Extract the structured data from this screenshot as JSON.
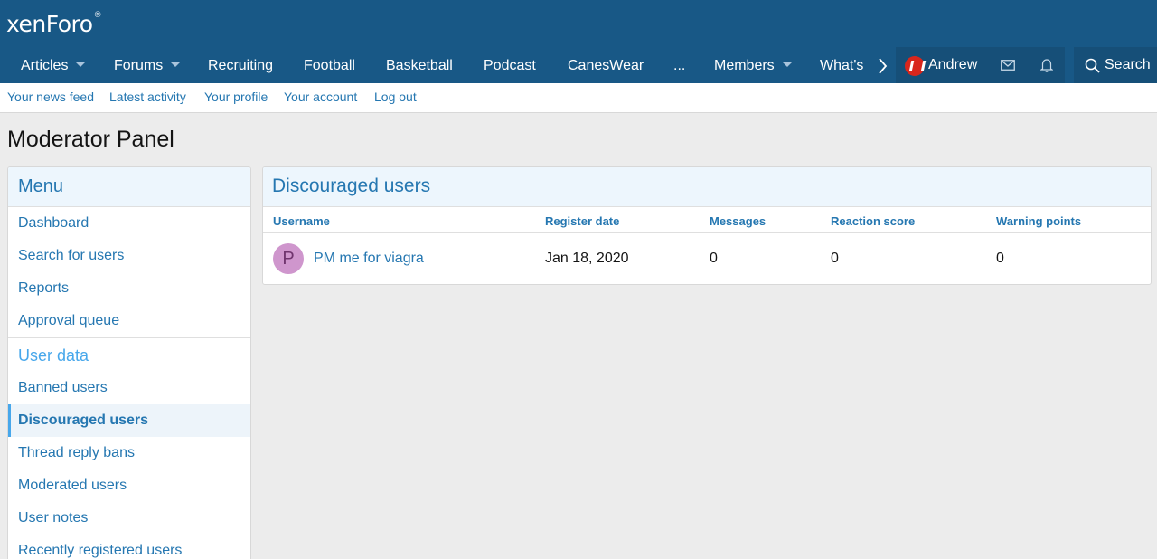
{
  "header": {
    "logo_text": "xenForo",
    "logo_mark": "®"
  },
  "nav": {
    "items": [
      {
        "label": "Articles",
        "dropdown": true
      },
      {
        "label": "Forums",
        "dropdown": true
      },
      {
        "label": "Recruiting",
        "dropdown": false
      },
      {
        "label": "Football",
        "dropdown": false
      },
      {
        "label": "Basketball",
        "dropdown": false
      },
      {
        "label": "Podcast",
        "dropdown": false
      },
      {
        "label": "CanesWear",
        "dropdown": false
      },
      {
        "label": "...",
        "dropdown": false
      },
      {
        "label": "Members",
        "dropdown": true
      },
      {
        "label": "What's",
        "dropdown": false
      }
    ],
    "user_name": "Andrew",
    "search_label": "Search",
    "icons": [
      "chevron-right-icon",
      "envelope-icon",
      "bell-icon",
      "search-icon"
    ]
  },
  "subnav": {
    "links": [
      "Your news feed",
      "Latest activity",
      "Your profile",
      "Your account",
      "Log out"
    ]
  },
  "page": {
    "title": "Moderator Panel"
  },
  "sidebar": {
    "menu_title": "Menu",
    "items": [
      "Dashboard",
      "Search for users",
      "Reports",
      "Approval queue"
    ],
    "section_title": "User data",
    "user_items": [
      "Banned users",
      "Discouraged users",
      "Thread reply bans",
      "Moderated users",
      "User notes",
      "Recently registered users"
    ],
    "active_item": "Discouraged users"
  },
  "main": {
    "title": "Discouraged users",
    "columns": [
      "Username",
      "Register date",
      "Messages",
      "Reaction score",
      "Warning points"
    ],
    "rows": [
      {
        "avatar_letter": "P",
        "username": "PM me for viagra",
        "register_date": "Jan 18, 2020",
        "messages": "0",
        "reaction_score": "0",
        "warning_points": "0"
      }
    ]
  },
  "colors": {
    "header_bg": "#185886",
    "link": "#2577b1",
    "accent": "#47a7eb",
    "avatar_bg": "#cf96cd"
  }
}
